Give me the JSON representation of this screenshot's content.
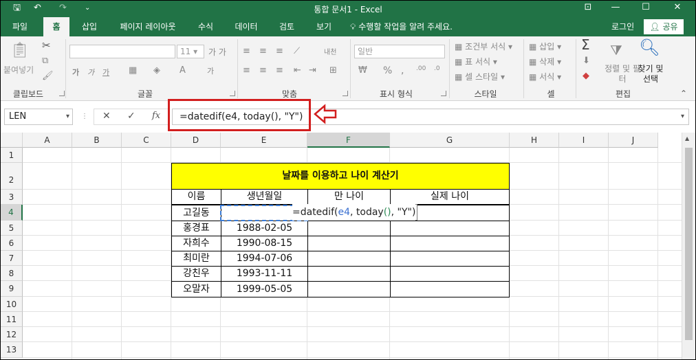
{
  "window": {
    "title": "통합 문서1 - Excel",
    "qa_save": "🖫",
    "qa_undo": "↶",
    "qa_redo": "↷",
    "qa_more": "₹",
    "min": "—",
    "max": "☐",
    "close": "✕",
    "restore": "⊡"
  },
  "tabs": [
    "파일",
    "홈",
    "삽입",
    "페이지 레이아웃",
    "수식",
    "데이터",
    "검토",
    "보기"
  ],
  "tell_me": "수행할 작업을 알려 주세요.",
  "login": "로그인",
  "share": "공유",
  "ribbon": {
    "clipboard": {
      "paste": "붙여넣기",
      "label": "클립보드"
    },
    "font": {
      "size": "11",
      "grow": "가 가",
      "bold": "가",
      "italic": "가",
      "underline": "가",
      "label": "글꼴"
    },
    "align": {
      "wrap": "내천",
      "label": "맞춤"
    },
    "number": {
      "format": "일반",
      "label": "표시 형식"
    },
    "styles": {
      "cond": "조건부 서식",
      "table": "표 서식",
      "cell": "셀 스타일",
      "label": "스타일"
    },
    "cells": {
      "insert": "삽입",
      "delete": "삭제",
      "format": "서식",
      "label": "셀"
    },
    "edit": {
      "sum": "Σ",
      "sort": "정렬 및 필터",
      "find": "찾기 및 선택",
      "label": "편집"
    }
  },
  "formula_bar": {
    "name_box": "LEN",
    "cancel": "✕",
    "enter": "✓",
    "fx": "fx",
    "formula": "=datedif(e4, today(), \"Y\")"
  },
  "grid": {
    "columns": [
      "A",
      "B",
      "C",
      "D",
      "E",
      "F",
      "G",
      "H",
      "I",
      "J"
    ],
    "rows": [
      "1",
      "2",
      "3",
      "4",
      "5",
      "6",
      "7",
      "8",
      "9",
      "10",
      "11",
      "12",
      "13"
    ],
    "table_title": "날짜를 이용하고 나이 계산기",
    "headers": [
      "이름",
      "생년월일",
      "만 나이",
      "실제 나이"
    ],
    "data": [
      {
        "name": "고길동",
        "birth": "",
        "edit": "=datedif(e4, today(), \"Y\")"
      },
      {
        "name": "홍경표",
        "birth": "1988-02-05"
      },
      {
        "name": "자희수",
        "birth": "1990-08-15"
      },
      {
        "name": "최미란",
        "birth": "1994-07-06"
      },
      {
        "name": "강친우",
        "birth": "1993-11-11"
      },
      {
        "name": "오말자",
        "birth": "1999-05-05"
      }
    ],
    "edit_parts": {
      "p1": "=datedif(",
      "ref": "e4",
      "p2": ", today",
      "par": "()",
      "p3": ", \"Y\")"
    }
  }
}
